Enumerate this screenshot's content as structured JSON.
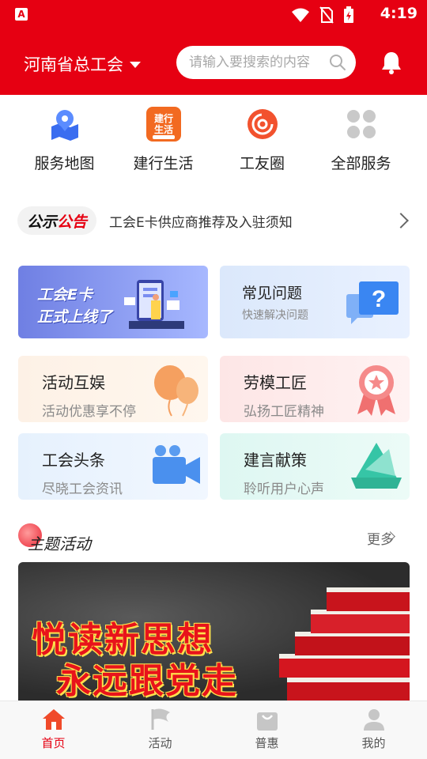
{
  "status_bar": {
    "time": "4:19",
    "app_badge": "A"
  },
  "header": {
    "region": "河南省总工会",
    "search_placeholder": "请输入要搜索的内容"
  },
  "quick_access": [
    {
      "label": "服务地图",
      "icon": "map-pin-icon"
    },
    {
      "label": "建行生活",
      "icon": "ccb-life-icon",
      "icon_text": "建行\n生活"
    },
    {
      "label": "工友圈",
      "icon": "circle-swirl-icon"
    },
    {
      "label": "全部服务",
      "icon": "grid-icon"
    }
  ],
  "notice": {
    "tag_part1": "公示",
    "tag_part2": "公告",
    "text": "工会E卡供应商推荐及入驻须知"
  },
  "banners": {
    "ecard_line1": "工会E卡",
    "ecard_line2": "正式上线了",
    "faq_title": "常见问题",
    "faq_sub": "快速解决问题"
  },
  "cards": [
    {
      "title": "活动互娱",
      "sub": "活动优惠享不停"
    },
    {
      "title": "劳模工匠",
      "sub": "弘扬工匠精神"
    },
    {
      "title": "工会头条",
      "sub": "尽晓工会资讯"
    },
    {
      "title": "建言献策",
      "sub": "聆听用户心声"
    }
  ],
  "section": {
    "title": "主题活动",
    "more": "更多"
  },
  "feature": {
    "line1": "悦读新思想",
    "line2": "永远跟党走"
  },
  "tabbar": [
    {
      "label": "首页",
      "active": true
    },
    {
      "label": "活动",
      "active": false
    },
    {
      "label": "普惠",
      "active": false
    },
    {
      "label": "我的",
      "active": false
    }
  ],
  "colors": {
    "brand_red": "#e60012",
    "accent_blue": "#3a6df0"
  }
}
